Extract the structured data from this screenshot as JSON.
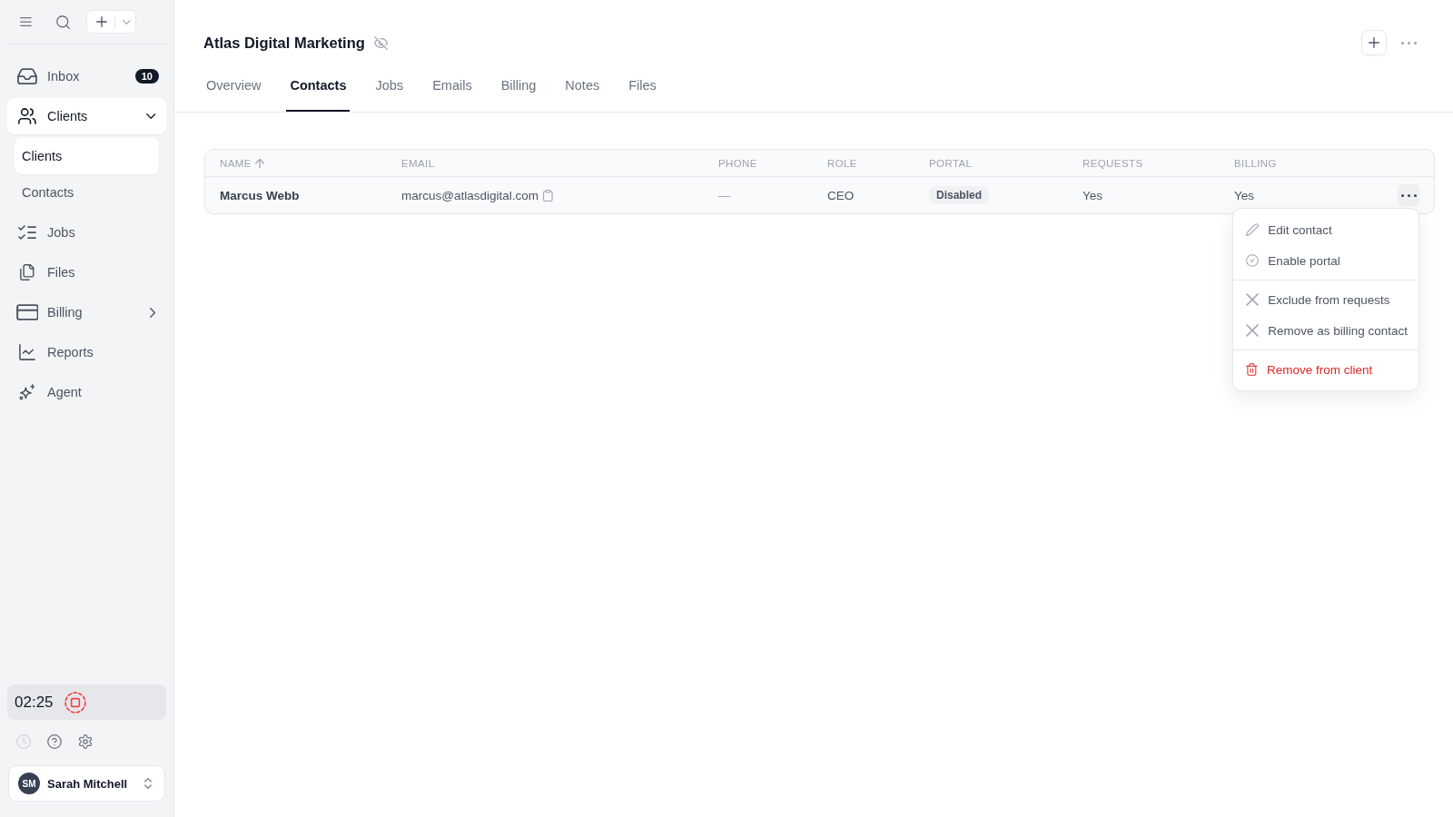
{
  "sidebar": {
    "nav": [
      {
        "kind": "link",
        "label": "Inbox",
        "badge": "10",
        "selected": false
      },
      {
        "kind": "group",
        "label": "Clients",
        "selected": true,
        "expanded": true,
        "children": [
          {
            "label": "Clients",
            "selected": true
          },
          {
            "label": "Contacts",
            "selected": false
          }
        ]
      },
      {
        "kind": "link",
        "label": "Jobs",
        "selected": false
      },
      {
        "kind": "link",
        "label": "Files",
        "selected": false
      },
      {
        "kind": "group",
        "label": "Billing",
        "selected": false,
        "expanded": false
      },
      {
        "kind": "link",
        "label": "Reports",
        "selected": false
      },
      {
        "kind": "link",
        "label": "Agent",
        "selected": false
      }
    ],
    "timer": {
      "time": "02:25"
    },
    "user": {
      "initials": "SM",
      "name": "Sarah Mitchell"
    }
  },
  "header": {
    "title": "Atlas Digital Marketing"
  },
  "tabs": [
    {
      "label": "Overview",
      "selected": false
    },
    {
      "label": "Contacts",
      "selected": true
    },
    {
      "label": "Jobs",
      "selected": false
    },
    {
      "label": "Emails",
      "selected": false
    },
    {
      "label": "Billing",
      "selected": false
    },
    {
      "label": "Notes",
      "selected": false
    },
    {
      "label": "Files",
      "selected": false
    }
  ],
  "table": {
    "columns": [
      {
        "label": "NAME",
        "sorted": true
      },
      {
        "label": "EMAIL",
        "sorted": false
      },
      {
        "label": "PHONE",
        "sorted": false
      },
      {
        "label": "ROLE",
        "sorted": false
      },
      {
        "label": "PORTAL",
        "sorted": false
      },
      {
        "label": "REQUESTS",
        "sorted": false
      },
      {
        "label": "BILLING",
        "sorted": false
      }
    ],
    "rows": [
      {
        "name": "Marcus Webb",
        "email": "marcus@atlasdigital.com",
        "phone": "—",
        "role": "CEO",
        "portal": "Disabled",
        "requests": "Yes",
        "billing": "Yes"
      }
    ]
  },
  "row_menu": {
    "groups": [
      [
        {
          "kind": "edit",
          "label": "Edit contact"
        },
        {
          "kind": "enable",
          "label": "Enable portal"
        }
      ],
      [
        {
          "kind": "exclude",
          "label": "Exclude from requests"
        },
        {
          "kind": "remove",
          "label": "Remove as billing contact"
        }
      ],
      [
        {
          "kind": "delete",
          "label": "Remove from client"
        }
      ]
    ]
  }
}
